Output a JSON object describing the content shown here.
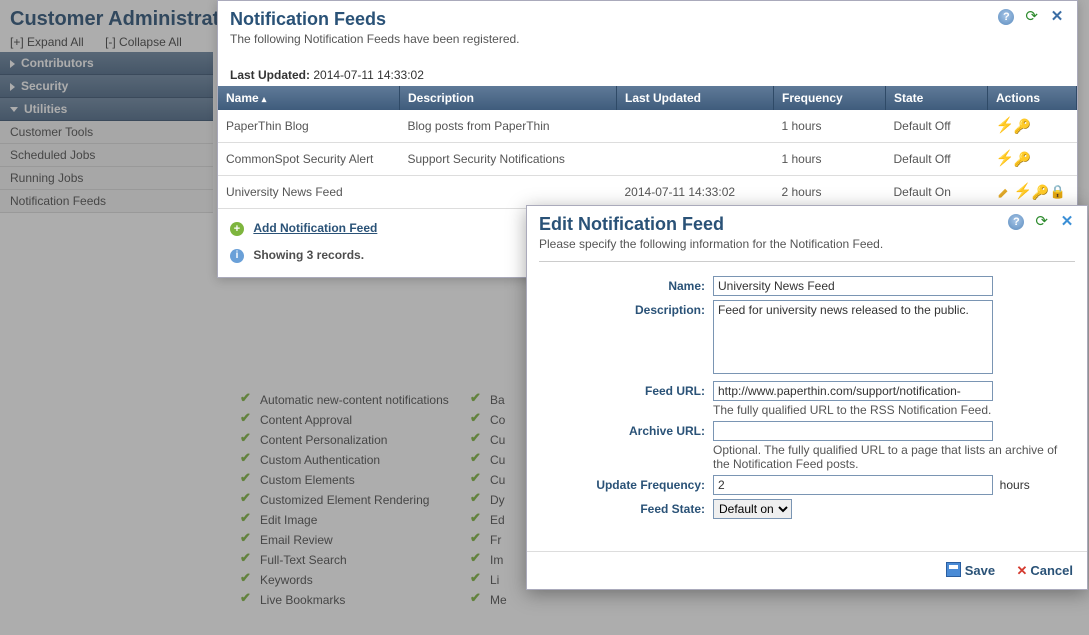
{
  "page": {
    "title": "Customer Administration",
    "expand": "[+] Expand All",
    "collapse": "[-] Collapse All"
  },
  "sidebar": {
    "sections": [
      {
        "label": "Contributors",
        "open": false,
        "items": []
      },
      {
        "label": "Security",
        "open": false,
        "items": []
      },
      {
        "label": "Utilities",
        "open": true,
        "items": [
          "Customer Tools",
          "Scheduled Jobs",
          "Running Jobs",
          "Notification Feeds"
        ]
      }
    ]
  },
  "bg_features": {
    "col1": [
      "Automatic new-content notifications",
      "Content Approval",
      "Content Personalization",
      "Custom Authentication",
      "Custom Elements",
      "Customized Element Rendering",
      "Edit Image",
      "Email Review",
      "Full-Text Search",
      "Keywords",
      "Live Bookmarks"
    ],
    "col2": [
      "Ba",
      "Co",
      "Cu",
      "Cu",
      "Cu",
      "Dy",
      "Ed",
      "Fr",
      "Im",
      "Li",
      "Me"
    ]
  },
  "feeds_dialog": {
    "title": "Notification Feeds",
    "subtitle": "The following Notification Feeds have been registered.",
    "last_updated_label": "Last Updated:",
    "last_updated_value": "2014-07-11 14:33:02",
    "columns": [
      "Name",
      "Description",
      "Last Updated",
      "Frequency",
      "State",
      "Actions"
    ],
    "rows": [
      {
        "name": "PaperThin Blog",
        "desc": "Blog posts from PaperThin",
        "updated": "",
        "freq": "1 hours",
        "state": "Default Off",
        "actions": [
          "bolt",
          "key"
        ]
      },
      {
        "name": "CommonSpot Security Alert",
        "desc": "Support Security Notifications",
        "updated": "",
        "freq": "1 hours",
        "state": "Default Off",
        "actions": [
          "bolt",
          "key"
        ]
      },
      {
        "name": "University News Feed",
        "desc": "",
        "updated": "2014-07-11 14:33:02",
        "freq": "2 hours",
        "state": "Default On",
        "actions": [
          "edit",
          "bolt",
          "key",
          "lock"
        ]
      }
    ],
    "add_link": "Add Notification Feed",
    "showing": "Showing 3 records."
  },
  "edit_dialog": {
    "title": "Edit Notification Feed",
    "subtitle": "Please specify the following information for the Notification Feed.",
    "labels": {
      "name": "Name:",
      "desc": "Description:",
      "feed_url": "Feed URL:",
      "archive_url": "Archive URL:",
      "freq": "Update Frequency:",
      "state": "Feed State:"
    },
    "values": {
      "name": "University News Feed",
      "desc": "Feed for university news released to the public.",
      "feed_url": "http://www.paperthin.com/support/notification-",
      "archive_url": "",
      "freq": "2",
      "freq_unit": "hours",
      "state": "Default on"
    },
    "hints": {
      "feed_url": "The fully qualified URL to the RSS Notification Feed.",
      "archive_url": "Optional. The fully qualified URL to a page that lists an archive of the Notification Feed posts."
    },
    "buttons": {
      "save": "Save",
      "cancel": "Cancel"
    }
  },
  "icons": {
    "help": "?",
    "refresh": "⟳",
    "close": "✕"
  }
}
